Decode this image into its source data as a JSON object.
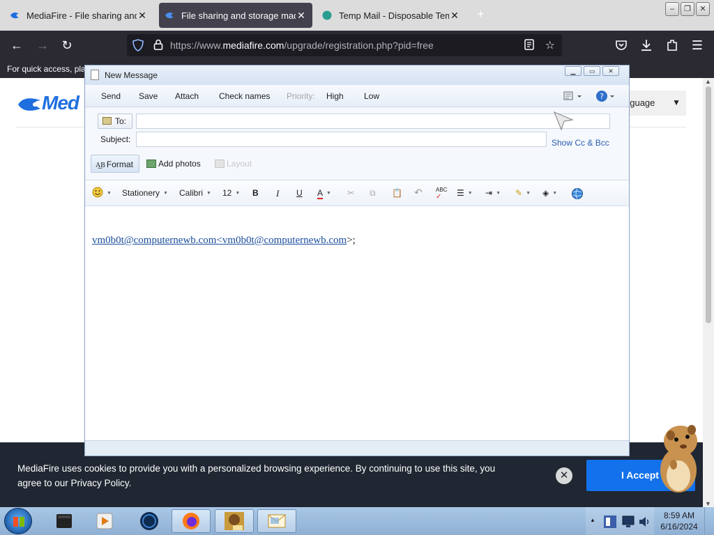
{
  "browser": {
    "tabs": [
      {
        "title": "MediaFire - File sharing and sto",
        "active": false
      },
      {
        "title": "File sharing and storage made",
        "active": true
      },
      {
        "title": "Temp Mail - Disposable Tempo",
        "active": false
      }
    ],
    "url_prefix": "https://www.",
    "url_domain": "mediafire.com",
    "url_path": "/upgrade/registration.php?pid=free",
    "bookmarks_text": "For quick access, plac"
  },
  "page": {
    "logo_text": "Med",
    "language_label": "nguage",
    "cookie_text": "MediaFire uses cookies to provide you with a personalized browsing experience. By continuing to use this site, you agree to our Privacy Policy.",
    "accept_label": "I Accept"
  },
  "message": {
    "window_title": "New Message",
    "toolbar": {
      "send": "Send",
      "save": "Save",
      "attach": "Attach",
      "check_names": "Check names",
      "priority": "Priority:",
      "high": "High",
      "low": "Low"
    },
    "to_label": "To:",
    "to_value": "",
    "subject_label": "Subject:",
    "subject_value": "",
    "show_cc_bcc": "Show Cc & Bcc",
    "format_label": "Format",
    "add_photos_label": "Add photos",
    "layout_label": "Layout",
    "format_bar": {
      "stationery": "Stationery",
      "font": "Calibri",
      "size": "12",
      "bold": "B",
      "italic": "I",
      "underline": "U",
      "font_color": "A"
    },
    "body_link": "vm0b0t@computernewb.com<vm0b0t@computernewb.com",
    "body_tail": ">;"
  },
  "taskbar": {
    "time": "8:59 AM",
    "date": "6/16/2024"
  },
  "colors": {
    "accent_blue": "#1271eb",
    "banner_bg": "#202732",
    "browser_dark": "#2b2a33",
    "message_header": "#dfe9f5"
  }
}
